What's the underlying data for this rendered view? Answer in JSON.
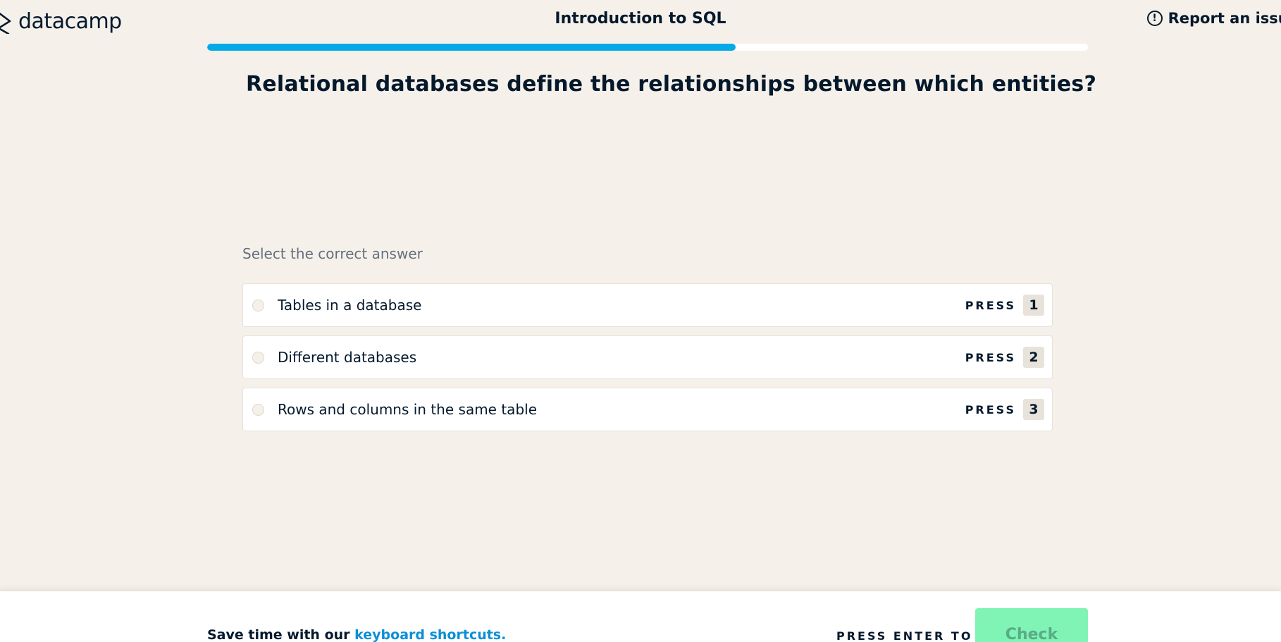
{
  "header": {
    "logo_text": "datacamp",
    "course_title": "Introduction to SQL",
    "report_label": "Report an issue"
  },
  "progress": {
    "fraction": 0.6,
    "color": "#03aae7"
  },
  "exercise": {
    "question": "Relational databases define the relationships between which entities?",
    "instruction": "Select the correct answer",
    "options": [
      {
        "label": "Tables in a database",
        "press_word": "PRESS",
        "key": "1"
      },
      {
        "label": "Different databases",
        "press_word": "PRESS",
        "key": "2"
      },
      {
        "label": "Rows and columns in the same table",
        "press_word": "PRESS",
        "key": "3"
      }
    ]
  },
  "footer": {
    "tip_prefix": "Save time with our ",
    "tip_link": "keyboard shortcuts.",
    "enter_hint": "PRESS ENTER TO",
    "check_label": "Check"
  },
  "colors": {
    "background": "#f5f1ea",
    "text": "#05192d",
    "link": "#0a8fd6",
    "check_button": "#7ff4b5"
  },
  "icons": {
    "logo": "datacamp-logo-icon",
    "report": "exclamation-circle-icon",
    "option_state": "radio-unchecked-icon"
  }
}
